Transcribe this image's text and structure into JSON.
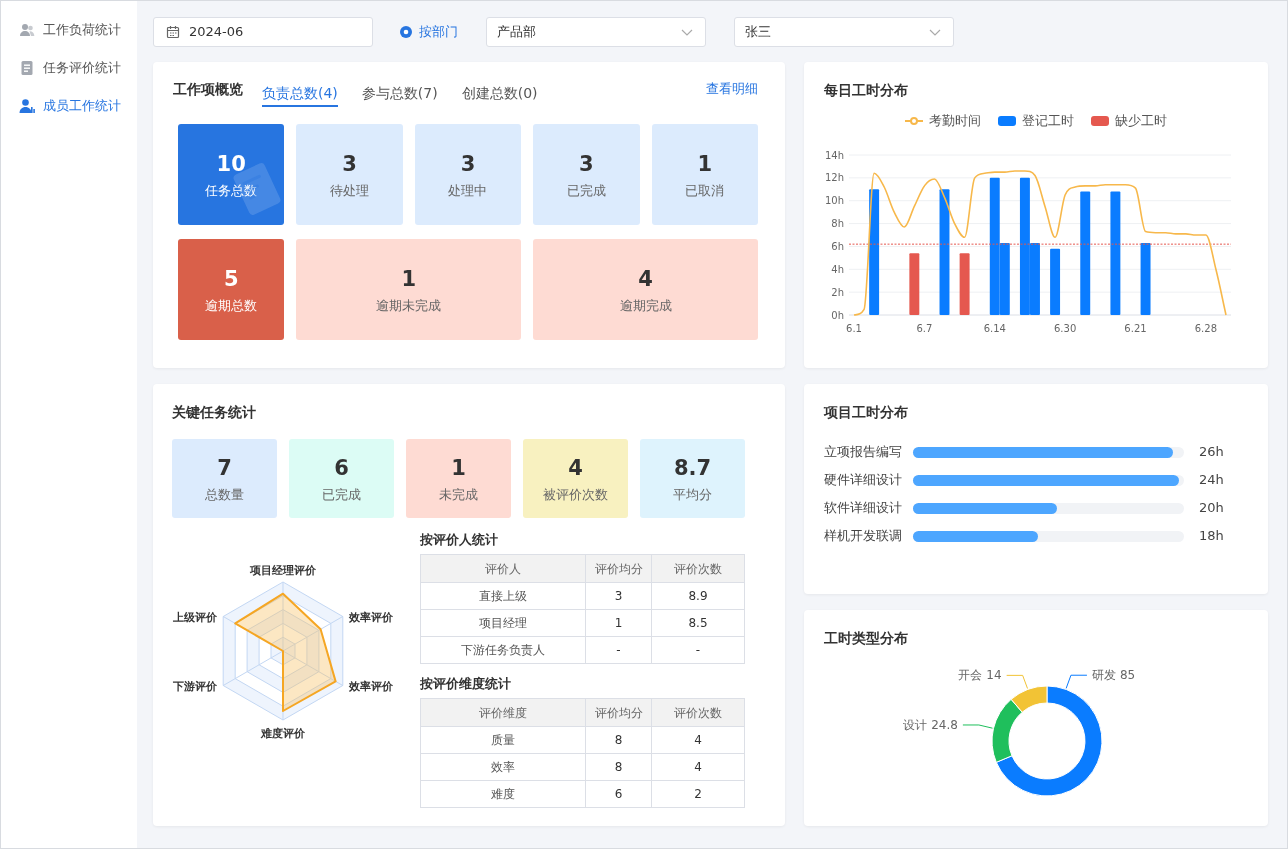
{
  "sidebar": {
    "items": [
      {
        "label": "工作负荷统计",
        "selected": false
      },
      {
        "label": "任务评价统计",
        "selected": false
      },
      {
        "label": "成员工作统计",
        "selected": true
      }
    ]
  },
  "filters": {
    "date": {
      "value": "2024-06"
    },
    "radio": {
      "label": "按部门",
      "checked": true
    },
    "selects": [
      {
        "value": "产品部"
      },
      {
        "value": "张三"
      }
    ]
  },
  "overview": {
    "title": "工作项概览",
    "tabs": [
      {
        "label": "负责总数(4)",
        "selected": true
      },
      {
        "label": "参与总数(7)",
        "selected": false
      },
      {
        "label": "创建总数(0)",
        "selected": false
      }
    ],
    "link": "查看明细",
    "rows": [
      [
        {
          "value": "10",
          "label": "任务总数",
          "color": "#2775e0",
          "kind": "summary"
        },
        {
          "value": "3",
          "label": "待处理",
          "color": "#dcebfd",
          "kind": "plain"
        },
        {
          "value": "3",
          "label": "处理中",
          "color": "#dcebfd",
          "kind": "plain"
        },
        {
          "value": "3",
          "label": "已完成",
          "color": "#dcebfd",
          "kind": "plain"
        },
        {
          "value": "1",
          "label": "已取消",
          "color": "#dcebfd",
          "kind": "plain"
        }
      ],
      [
        {
          "value": "5",
          "label": "逾期总数",
          "color": "#d9604a",
          "kind": "plain"
        },
        {
          "value": "1",
          "label": "逾期未完成",
          "color": "#fedbd3",
          "kind": "plain"
        },
        {
          "value": "4",
          "label": "逾期完成",
          "color": "#fedbd3",
          "kind": "plain"
        }
      ]
    ]
  },
  "daily_hours": {
    "title": "每日工时分布",
    "chart_data": {
      "type": "bar",
      "grid": true,
      "categories": [
        "6.1",
        null,
        null,
        null,
        null,
        null,
        null,
        "6.7",
        null,
        null,
        null,
        null,
        null,
        null,
        "6.14",
        null,
        null,
        null,
        null,
        null,
        null,
        "6.30",
        null,
        null,
        null,
        null,
        null,
        null,
        "6.21",
        null,
        null,
        null,
        null,
        null,
        null,
        "6.28",
        null,
        null
      ],
      "series": [
        {
          "name": "考勤时间",
          "color": "#f7b84b",
          "type": "line",
          "values": [
            0,
            0.5,
            12.4,
            11.2,
            9.0,
            7.7,
            9.5,
            11.3,
            11.9,
            10.3,
            8.0,
            6.8,
            12.0,
            12.4,
            12.5,
            12.5,
            12.6,
            12.6,
            12.2,
            9.5,
            6.8,
            10.5,
            11.2,
            11.3,
            11.3,
            11.4,
            11.4,
            11.4,
            11.1,
            7.3,
            7.2,
            7.2,
            7.1,
            7.1,
            7.0,
            7.0,
            4.0,
            0
          ]
        },
        {
          "name": "登记工时",
          "color": "#0a7cff",
          "values": [
            null,
            null,
            11,
            null,
            null,
            null,
            null,
            null,
            null,
            11,
            null,
            null,
            null,
            null,
            12,
            6.3,
            null,
            12,
            6.3,
            null,
            5.8,
            null,
            null,
            10.8,
            null,
            null,
            10.8,
            null,
            null,
            6.3,
            null,
            null,
            null,
            null,
            null,
            null,
            null,
            null
          ]
        },
        {
          "name": "缺少工时",
          "color": "#e5584f",
          "values": [
            null,
            null,
            null,
            null,
            null,
            null,
            5.4,
            null,
            null,
            null,
            null,
            5.4,
            null,
            null,
            null,
            null,
            null,
            null,
            null,
            null,
            null,
            null,
            null,
            null,
            null,
            null,
            null,
            null,
            null,
            null,
            null,
            null,
            null,
            null,
            null,
            null,
            null,
            null
          ]
        }
      ],
      "ylim": [
        0,
        14
      ],
      "yticks": [
        {
          "value": 0,
          "label": "0h"
        },
        {
          "value": 2,
          "label": "2h"
        },
        {
          "value": 4,
          "label": "4h"
        },
        {
          "value": 6,
          "label": "6h"
        },
        {
          "value": 8,
          "label": "8h"
        },
        {
          "value": 10,
          "label": "10h"
        },
        {
          "value": 12,
          "label": "12h"
        },
        {
          "value": 14,
          "label": "14h"
        }
      ],
      "ref_lines": [
        {
          "axis": "y",
          "value": 6.2
        }
      ]
    }
  },
  "key_tasks": {
    "title": "关键任务统计",
    "stats": [
      {
        "value": "7",
        "label": "总数量",
        "color": "#dcebfd"
      },
      {
        "value": "6",
        "label": "已完成",
        "color": "#dcfcf5"
      },
      {
        "value": "1",
        "label": "未完成",
        "color": "#fedbd3"
      },
      {
        "value": "4",
        "label": "被评价次数",
        "color": "#f8f1c0"
      },
      {
        "value": "8.7",
        "label": "平均分",
        "color": "#def3fd"
      }
    ],
    "radar": {
      "axes": [
        "项目经理评价",
        "效率评价",
        "效率评价",
        "难度评价",
        "下游评价",
        "上级评价"
      ]
    },
    "tables": [
      {
        "title": "按评价人统计",
        "columns": [
          "评价人",
          "评价均分",
          "评价次数"
        ],
        "rows": [
          [
            "直接上级",
            "3",
            "8.9"
          ],
          [
            "项目经理",
            "1",
            "8.5"
          ],
          [
            "下游任务负责人",
            "-",
            "-"
          ]
        ]
      },
      {
        "title": "按评价维度统计",
        "columns": [
          "评价维度",
          "评价均分",
          "评价次数"
        ],
        "rows": [
          [
            "质量",
            "8",
            "4"
          ],
          [
            "效率",
            "8",
            "4"
          ],
          [
            "难度",
            "6",
            "2"
          ]
        ]
      }
    ]
  },
  "project_hours": {
    "title": "项目工时分布",
    "items": [
      {
        "name": "立项报告编写",
        "level": 0.96,
        "reading": "26h"
      },
      {
        "name": "硬件详细设计",
        "level": 0.98,
        "reading": "24h"
      },
      {
        "name": "软件详细设计",
        "level": 0.53,
        "reading": "20h"
      },
      {
        "name": "样机开发联调",
        "level": 0.46,
        "reading": "18h"
      }
    ]
  },
  "hours_types": {
    "title": "工时类型分布",
    "chart_data": {
      "type": "donut",
      "categories": [
        "研发",
        "设计",
        "开会"
      ],
      "values": [
        85,
        24.8,
        14
      ],
      "colors": [
        "#0a7cff",
        "#1fbf5c",
        "#f2c335"
      ],
      "data_labels": true
    }
  }
}
